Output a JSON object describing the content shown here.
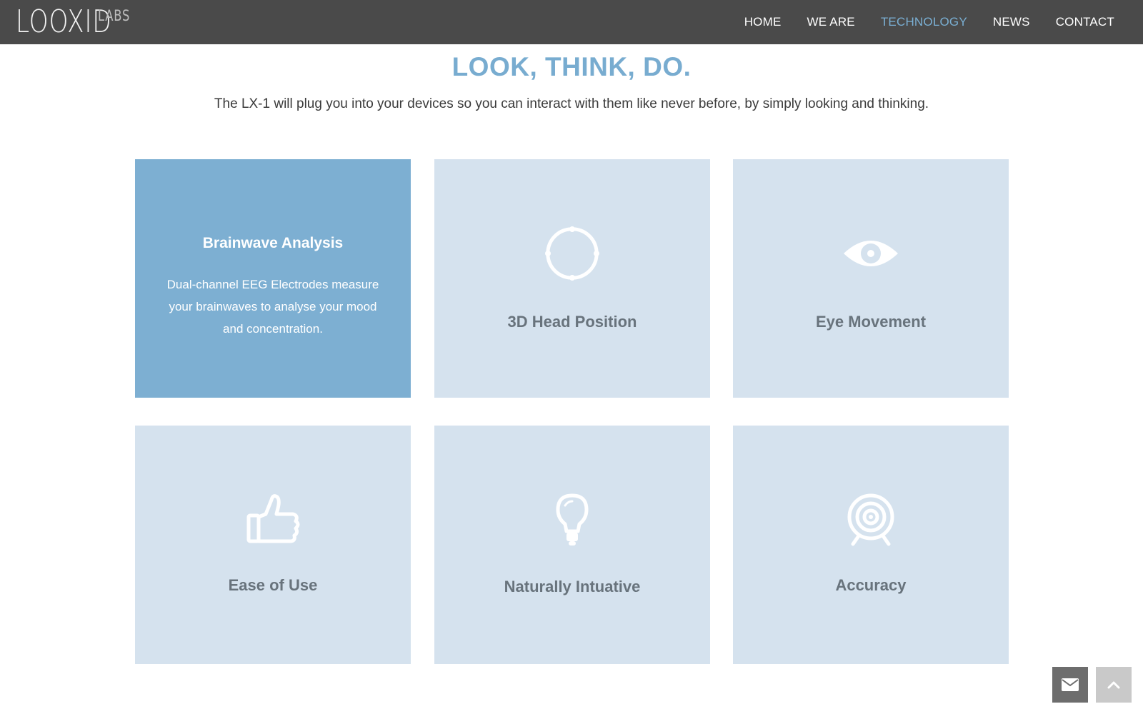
{
  "header": {
    "logo_main": "LOOXID",
    "logo_sub": "LABS",
    "nav": [
      "HOME",
      "WE ARE",
      "TECHNOLOGY",
      "NEWS",
      "CONTACT"
    ],
    "active_nav": "TECHNOLOGY"
  },
  "hero": {
    "title": "LOOK, THINK, DO.",
    "subtitle": "The LX-1 will plug you into your devices so you can interact with them like never before, by simply looking and thinking."
  },
  "features": [
    {
      "title": "Brainwave Analysis",
      "description": "Dual-channel EEG Electrodes measure your brainwaves to analyse your mood and concentration.",
      "icon": "brain-icon",
      "state": "hovered"
    },
    {
      "title": "3D Head Position",
      "icon": "rotation-circle-icon"
    },
    {
      "title": "Eye Movement",
      "icon": "eye-icon"
    },
    {
      "title": "Ease of Use",
      "icon": "thumbs-up-icon"
    },
    {
      "title": "Naturally Intuative",
      "icon": "lightbulb-icon"
    },
    {
      "title": "Accuracy",
      "icon": "target-icon"
    }
  ],
  "floating_buttons": {
    "contact_icon": "envelope-icon",
    "top_icon": "chevron-up-icon"
  },
  "colors": {
    "navbar": "#4a4a4a",
    "accent": "#78acd0",
    "card": "#d5e2ee",
    "card_active": "#7dafd2",
    "card_text": "#68737c"
  }
}
